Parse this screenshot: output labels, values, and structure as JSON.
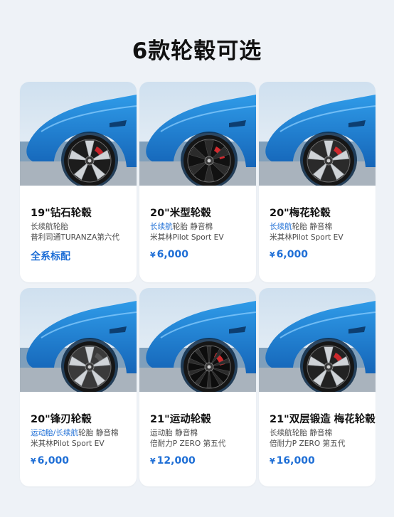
{
  "title": "6款轮毂可选",
  "wheels": [
    {
      "name": "19\"钻石轮毂",
      "tire_line1": [
        {
          "text": "长续航轮胎",
          "highlight": false
        }
      ],
      "tire_line2": "普利司通TURANZA第六代",
      "price_currency": "",
      "price": "全系标配",
      "rim_color": "#1c1c1c",
      "caliper_color": "#c7252b",
      "spoke_style": "diamond"
    },
    {
      "name": "20\"米型轮毂",
      "tire_line1": [
        {
          "text": "长续航",
          "highlight": true
        },
        {
          "text": "轮胎  静音棉",
          "highlight": false
        }
      ],
      "tire_line2": "米其林Pilot Sport EV",
      "price_currency": "¥",
      "price": "6,000",
      "rim_color": "#111111",
      "caliper_color": "#d12a2f",
      "spoke_style": "y-spoke"
    },
    {
      "name": "20\"梅花轮毂",
      "tire_line1": [
        {
          "text": "长续航",
          "highlight": true
        },
        {
          "text": "轮胎  静音棉",
          "highlight": false
        }
      ],
      "tire_line2": "米其林Pilot Sport EV",
      "price_currency": "¥",
      "price": "6,000",
      "rim_color": "#2a2a2a",
      "caliper_color": "#cf2a2e",
      "spoke_style": "plum"
    },
    {
      "name": "20\"锋刃轮毂",
      "tire_line1": [
        {
          "text": "运动胎/长续航",
          "highlight": true
        },
        {
          "text": "轮胎  静音棉",
          "highlight": false
        }
      ],
      "tire_line2": "米其林Pilot Sport EV",
      "price_currency": "¥",
      "price": "6,000",
      "rim_color": "#3a3a3a",
      "caliper_color": "#555555",
      "spoke_style": "blade"
    },
    {
      "name": "21\"运动轮毂",
      "tire_line1": [
        {
          "text": "运动胎  静音棉",
          "highlight": false
        }
      ],
      "tire_line2": "倍耐力P ZERO 第五代",
      "price_currency": "¥",
      "price": "12,000",
      "rim_color": "#0d0d0d",
      "caliper_color": "#d02a2c",
      "spoke_style": "sport"
    },
    {
      "name": "21\"双层锻造 梅花轮毂",
      "tire_line1": [
        {
          "text": "长续航轮胎  静音棉",
          "highlight": false
        }
      ],
      "tire_line2": "倍耐力P ZERO 第五代",
      "price_currency": "¥",
      "price": "16,000",
      "rim_color": "#222222",
      "caliper_color": "#cd282c",
      "spoke_style": "forged"
    }
  ],
  "colors": {
    "accent": "#1f6fd6",
    "car_body": "#1e86d6",
    "background": "#eef2f7"
  }
}
